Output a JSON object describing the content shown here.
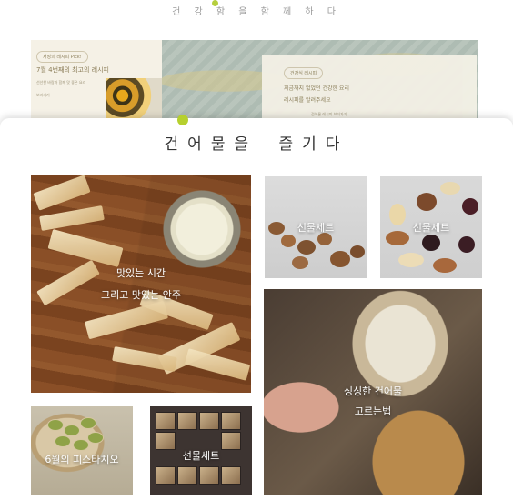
{
  "header": {
    "tagline": "건 강 함 을 함 께 하 다"
  },
  "promo": {
    "left_badge": "저장의 레시피 Pick!",
    "left_title": "7월 4번째의 최고의 레시피",
    "left_sub": "선선한 바람과 함께 맛 좋은 요리",
    "left_more": "보러가기",
    "card_badge": "건강식 레시피",
    "card_line1": "지금까지 없었던 건강한 요리",
    "card_line2": "레시피를 알려주세요",
    "card_line3": "건어물 레시피 보러가기"
  },
  "section": {
    "title": "건어물을  즐기다"
  },
  "tiles": {
    "fish": {
      "caption1": "맛있는 시간",
      "caption2": "그리고 맛있는 안주"
    },
    "nuts1": {
      "caption": "선물세트"
    },
    "nuts2": {
      "caption": "선물세트"
    },
    "mushroom": {
      "caption1": "싱싱한 건어물",
      "caption2": "고르는법"
    },
    "pistachio": {
      "caption": "6월의 피스타치오"
    },
    "gift": {
      "caption": "선물세트"
    }
  },
  "colors": {
    "accent": "#b6d02e",
    "text": "#333333"
  }
}
